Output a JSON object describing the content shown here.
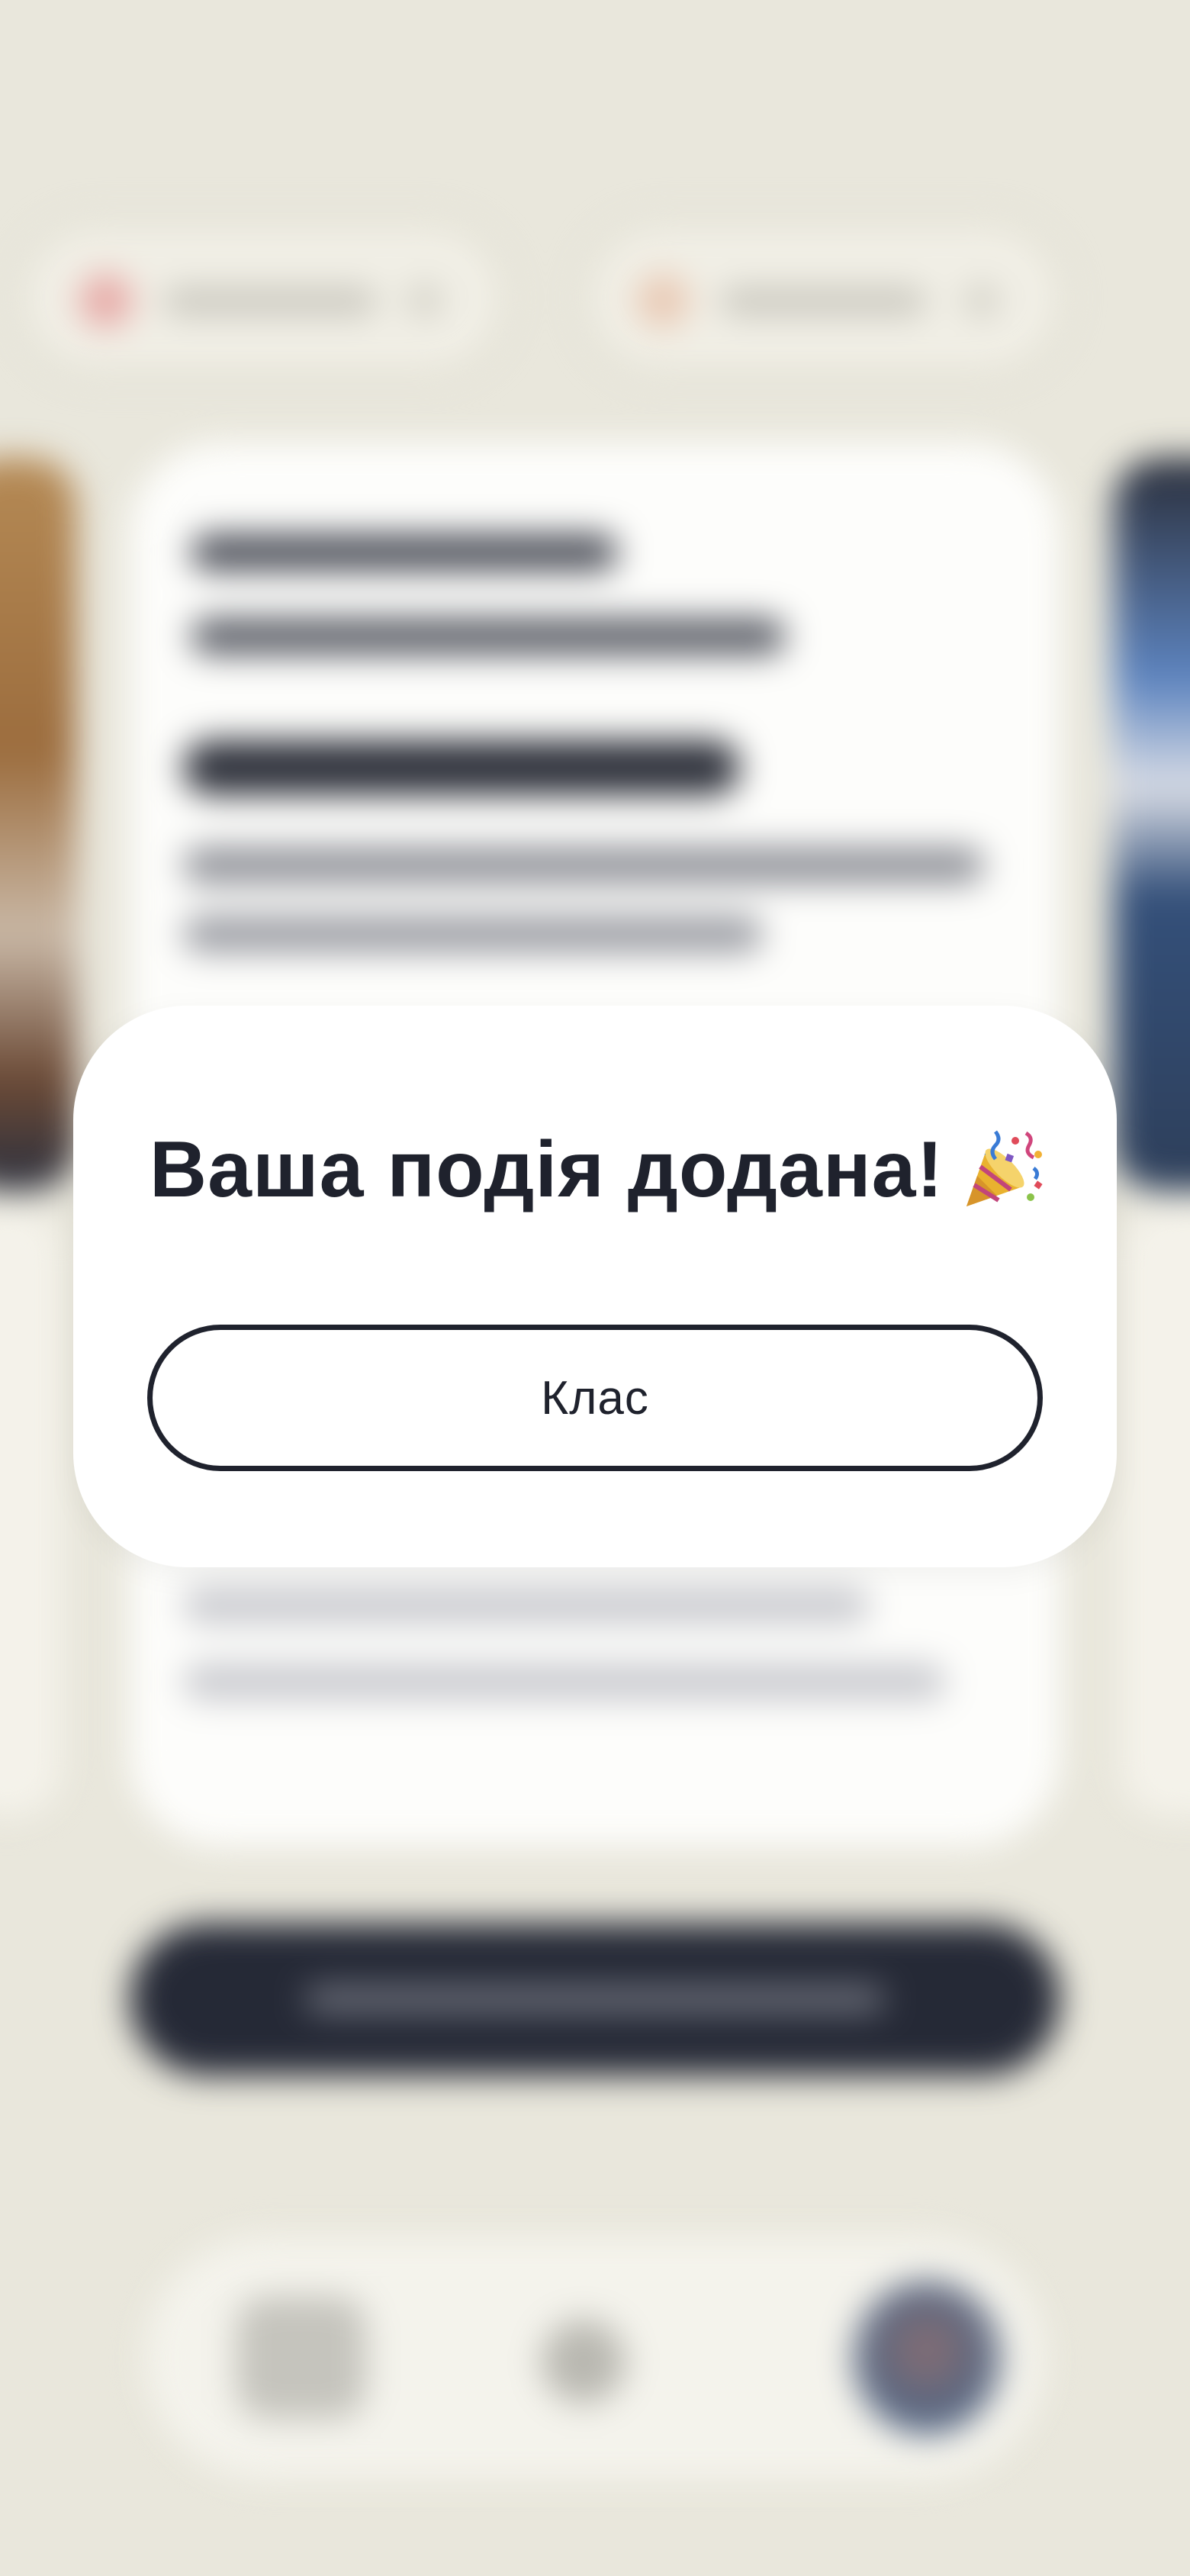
{
  "dialog": {
    "title": "Ваша подія додана!",
    "title_icon": "party-popper-icon",
    "button_label": "Клас"
  },
  "colors": {
    "background": "#e9e7dc",
    "dialog_background": "#ffffff",
    "text": "#1f222d",
    "button_border": "#1f222d",
    "dark_pill": "#252936"
  }
}
